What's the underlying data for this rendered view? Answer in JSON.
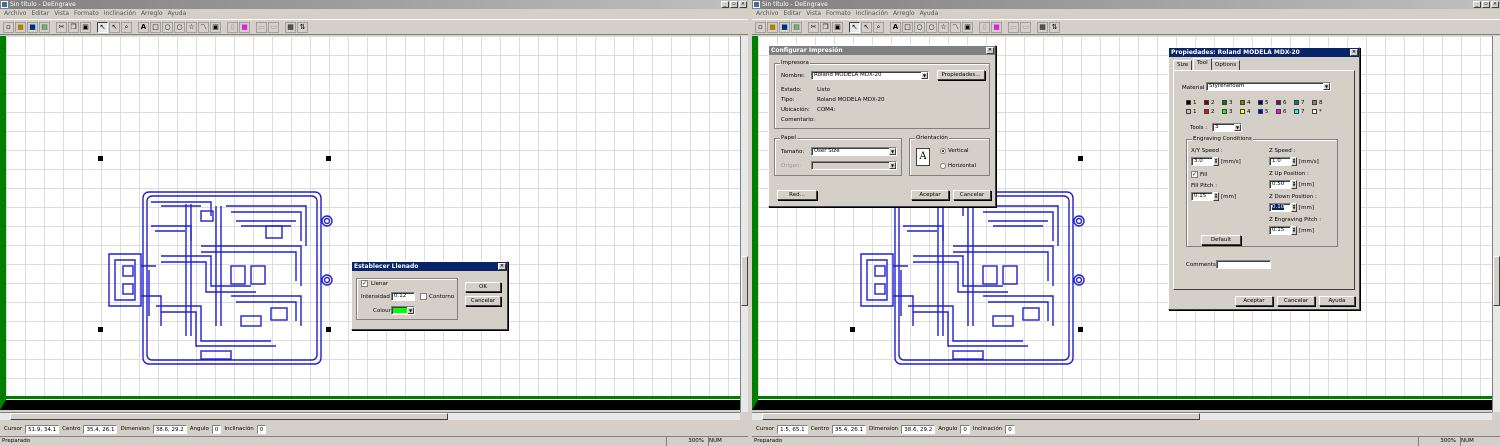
{
  "left": {
    "title": "Sin título - DeEngrave",
    "menu": [
      "Archivo",
      "Editar",
      "Vista",
      "Formato",
      "Inclinación",
      "Arreglo",
      "Ayuda"
    ],
    "info": {
      "cursor_label": "Cursor",
      "cursor": "51.9, 34.1",
      "centro_label": "Centro",
      "centro": "35.4, 26.1",
      "dimension_label": "Dimension",
      "dimension": "38.6, 29.2",
      "angulo_label": "Angulo",
      "angulo": "0",
      "inclinacion_label": "Inclinación",
      "inclinacion": "0"
    },
    "status": "Preparado",
    "zoom": "300%",
    "num": "NUM",
    "fill_dialog": {
      "title": "Establecer Llenado",
      "llenar": "Llenar",
      "intensidad_label": "Intensidad",
      "intensidad": "0.12",
      "contorno": "Contorno",
      "color_label": "Colour",
      "color": "#00ff00",
      "ok": "OK",
      "cancelar": "Cancelar"
    }
  },
  "right": {
    "title": "Sin título - DeEngrave",
    "menu": [
      "Archivo",
      "Editar",
      "Vista",
      "Formato",
      "Inclinación",
      "Arreglo",
      "Ayuda"
    ],
    "info": {
      "cursor_label": "Cursor",
      "cursor": "1.5, 65.1",
      "centro_label": "Centro",
      "centro": "35.4, 26.1",
      "dimension_label": "Dimension",
      "dimension": "38.6, 29.2",
      "angulo_label": "Angulo",
      "angulo": "0",
      "inclinacion_label": "Inclinación",
      "inclinacion": "0"
    },
    "status": "Preparado",
    "zoom": "300%",
    "num": "NUM",
    "print_dialog": {
      "title": "Configurar Impresión",
      "impresora": "Impresora",
      "nombre_label": "Nombre:",
      "nombre": "Roland MODELA MDX-20",
      "propiedades": "Propiedades...",
      "estado_label": "Estado:",
      "estado": "Listo",
      "tipo_label": "Tipo:",
      "tipo": "Roland MODELA MDX-20",
      "ubicacion_label": "Ubicación:",
      "ubicacion": "COM4:",
      "comentario_label": "Comentario:",
      "papel": "Papel",
      "tamano_label": "Tamaño:",
      "tamano": "User Size",
      "origen_label": "Origen:",
      "orientacion": "Orientación",
      "vertical": "Vertical",
      "horizontal": "Horizontal",
      "red": "Red...",
      "aceptar": "Aceptar",
      "cancelar": "Cancelar"
    },
    "props_dialog": {
      "title": "Propiedades: Roland MODELA MDX-20",
      "tabs": [
        "Size",
        "Tool",
        "Options"
      ],
      "material_label": "Material",
      "material": "Styrenefoam",
      "swatches_top": [
        "1",
        "2",
        "3",
        "4",
        "5",
        "6",
        "7",
        "8"
      ],
      "swatches_bottom": [
        "1",
        "2",
        "3",
        "4",
        "5",
        "6",
        "7",
        "*"
      ],
      "tools_label": "Tools :",
      "tools": "3",
      "engraving": "Engraving Conditions",
      "xy_speed_label": "X/Y Speed :",
      "xy_speed": "3.0",
      "unit_speed": "[mm/s]",
      "z_speed_label": "Z Speed :",
      "z_speed": "1.0",
      "fill": "Fill",
      "fill_pitch_label": "Fill Pitch :",
      "fill_pitch": "0.15",
      "unit_mm": "[mm]",
      "z_up_label": "Z Up Position :",
      "z_up": "0.50",
      "z_down_label": "Z Down Position :",
      "z_down": "0.10",
      "z_pitch_label": "Z Engraving Pitch :",
      "z_pitch": "0.15",
      "default": "Default",
      "comments_label": "Comments :",
      "aceptar": "Aceptar",
      "cancelar": "Cancelar",
      "ayuda": "Ayuda"
    }
  }
}
